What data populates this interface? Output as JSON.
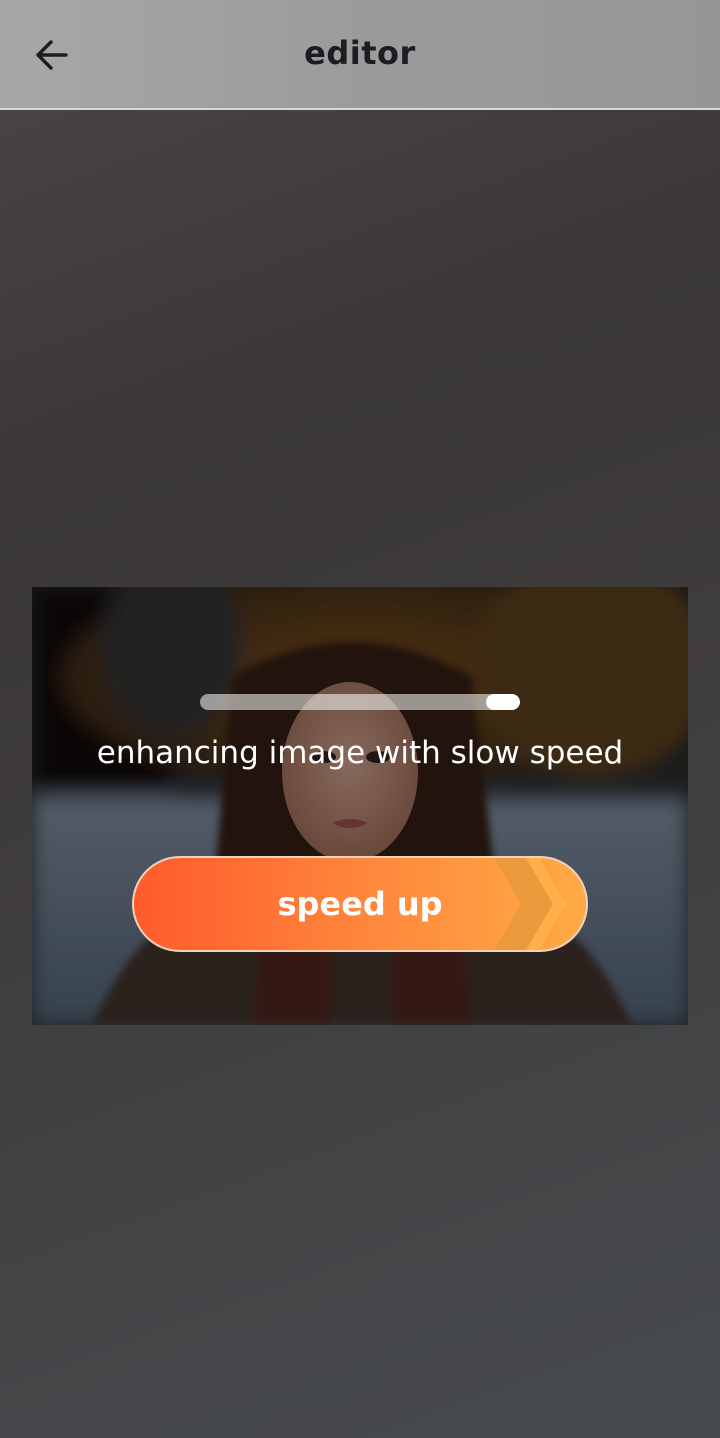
{
  "header": {
    "title": "editor",
    "back_icon": "arrow-left-icon"
  },
  "enhance": {
    "progress": 0.9,
    "status_text": "enhancing image with slow speed",
    "speed_up_label": "speed up",
    "button_icon": "double-chevron-right-icon"
  },
  "colors": {
    "button_gradient_start": "#ff5a2b",
    "button_gradient_end": "#ffaa45"
  }
}
